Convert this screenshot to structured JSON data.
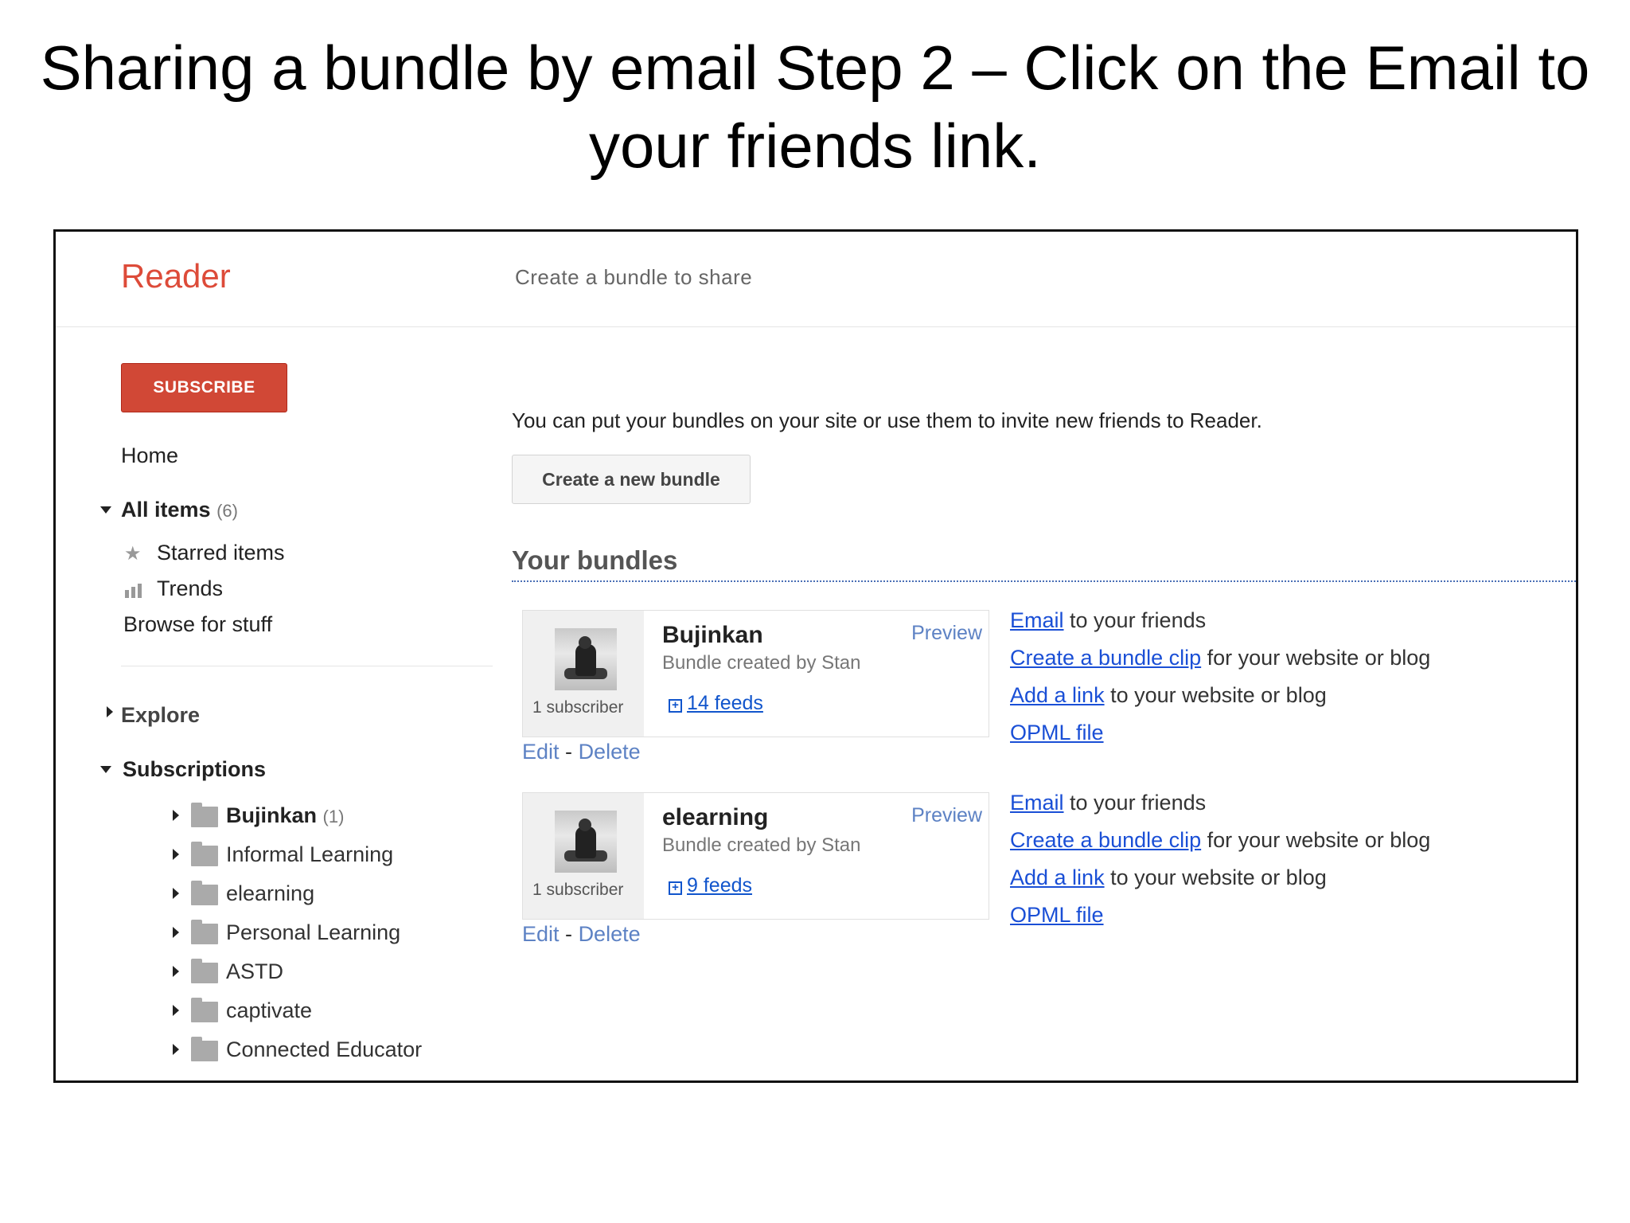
{
  "slide": {
    "title_line1": "Sharing a bundle by email Step 2 – Click on the Email to",
    "title_line2": "your friends link."
  },
  "app": {
    "name": "Reader",
    "page_heading": "Create a bundle to share",
    "accent": "#dd4b39"
  },
  "sidebar": {
    "subscribe_label": "SUBSCRIBE",
    "home": "Home",
    "all_items": {
      "label": "All items",
      "count": "(6)"
    },
    "starred": "Starred items",
    "trends": "Trends",
    "browse": "Browse for stuff",
    "explore": "Explore",
    "subscriptions_label": "Subscriptions",
    "folders": [
      {
        "label": "Bujinkan",
        "count": "(1)"
      },
      {
        "label": "Informal Learning"
      },
      {
        "label": "elearning"
      },
      {
        "label": "Personal Learning"
      },
      {
        "label": "ASTD"
      },
      {
        "label": "captivate"
      },
      {
        "label": "Connected Educator"
      }
    ]
  },
  "main": {
    "intro": "You can put your bundles on your site or use them to invite new friends to Reader.",
    "create_button": "Create a new bundle",
    "section_title": "Your bundles",
    "bundles": [
      {
        "name": "Bujinkan",
        "created_by": "Bundle created by Stan",
        "preview": "Preview",
        "subscribers": "1 subscriber",
        "feeds": "14 feeds",
        "edit": "Edit",
        "separator": "-",
        "delete": "Delete",
        "actions": [
          {
            "link": "Email",
            "rest": " to your friends"
          },
          {
            "link": "Create a bundle clip",
            "rest": " for your website or blog"
          },
          {
            "link": "Add a link",
            "rest": " to your website or blog"
          },
          {
            "link": "OPML file",
            "rest": ""
          }
        ]
      },
      {
        "name": "elearning",
        "created_by": "Bundle created by Stan",
        "preview": "Preview",
        "subscribers": "1 subscriber",
        "feeds": "9 feeds",
        "edit": "Edit",
        "separator": "-",
        "delete": "Delete",
        "actions": [
          {
            "link": "Email",
            "rest": " to your friends"
          },
          {
            "link": "Create a bundle clip",
            "rest": " for your website or blog"
          },
          {
            "link": "Add a link",
            "rest": " to your website or blog"
          },
          {
            "link": "OPML file",
            "rest": ""
          }
        ]
      }
    ]
  }
}
